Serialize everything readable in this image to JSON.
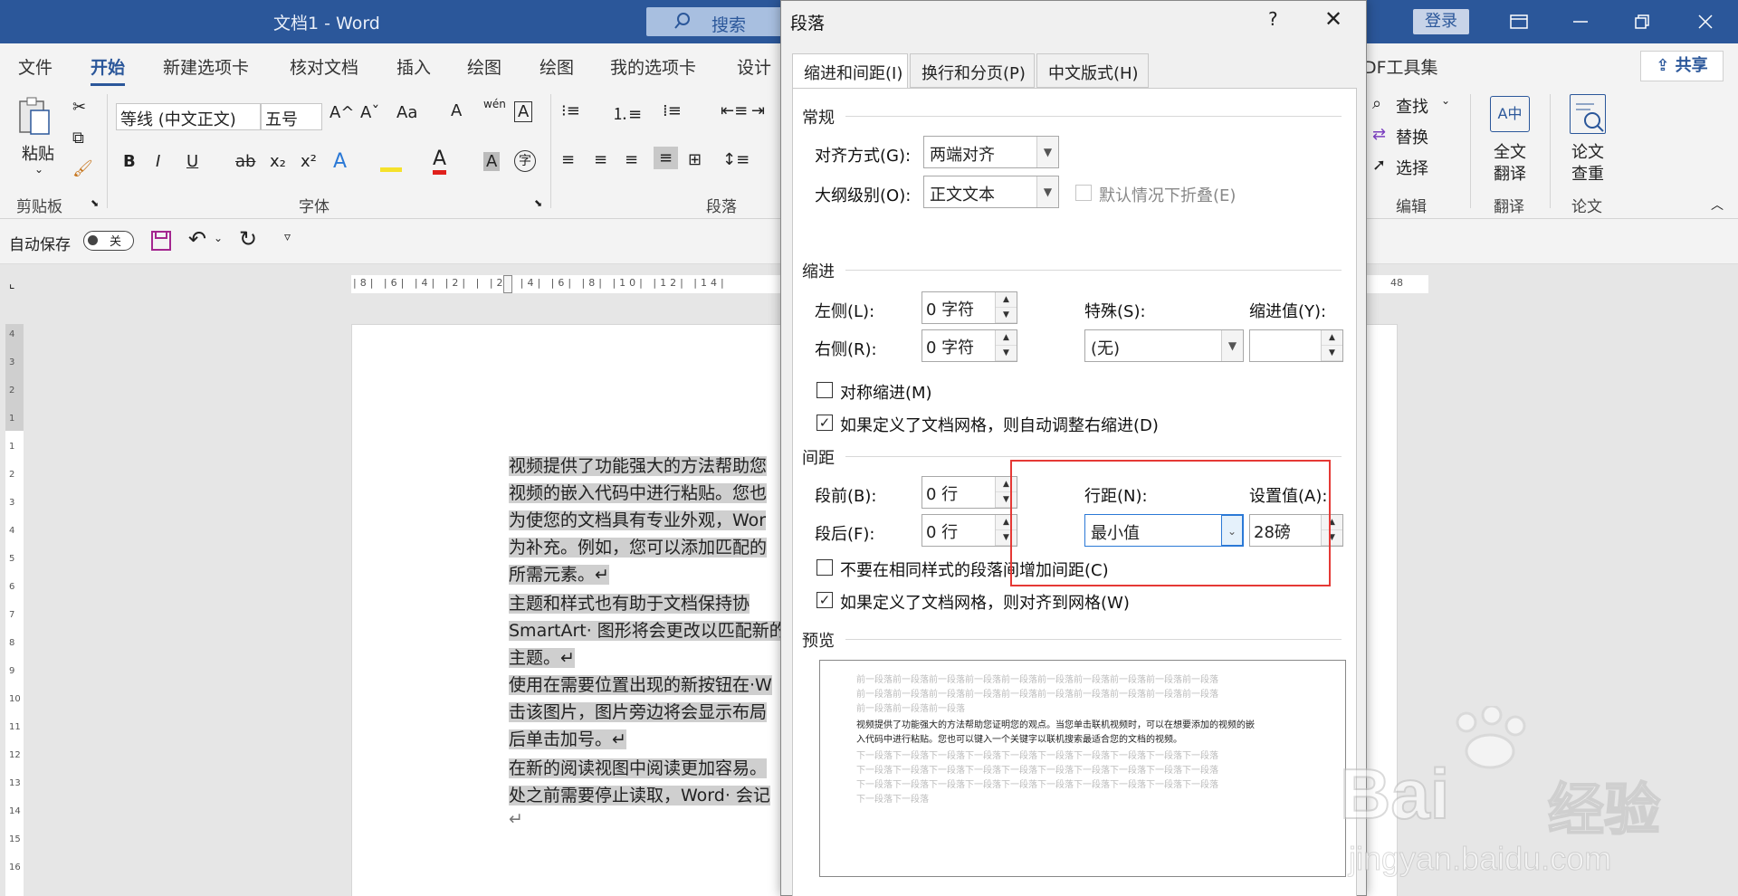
{
  "window": {
    "title": "文档1  -  Word",
    "search_label": "搜索",
    "login_label": "登录"
  },
  "ribbon_tabs": [
    "文件",
    "开始",
    "新建选项卡",
    "核对文档",
    "插入",
    "绘图",
    "绘图",
    "我的选项卡",
    "设计"
  ],
  "ribbon_tab_partial": "DF工具集",
  "share_label": "共享",
  "clipboard": {
    "paste_label": "粘贴",
    "group_label": "剪贴板"
  },
  "font": {
    "font_name": "等线 (中文正文)",
    "font_size": "五号",
    "group_label": "字体",
    "buttons": [
      "B",
      "I",
      "U",
      "ab",
      "x₂",
      "x²"
    ]
  },
  "paragraph": {
    "group_label": "段落"
  },
  "editing": {
    "find_label": "查找",
    "replace_label": "替换",
    "select_label": "选择",
    "group_label": "编辑"
  },
  "translate": {
    "btn_label_1": "全文",
    "btn_label_2": "翻译",
    "group_label": "翻译"
  },
  "paper": {
    "btn_label_1": "论文",
    "btn_label_2": "查重",
    "group_label": "论文"
  },
  "qat": {
    "autosave_label": "自动保存",
    "toggle_state": "关"
  },
  "ruler_top_ticks": "|8| |6| |4| |2| |  |2| |4| |6| |8| |10| |12| |14|",
  "ruler_right_label": "48",
  "ruler_left_ticks": [
    "4",
    "3",
    "2",
    "1",
    "1",
    "2",
    "3",
    "4",
    "5",
    "6",
    "7",
    "8",
    "9",
    "10",
    "11",
    "12",
    "13",
    "14",
    "15",
    "16"
  ],
  "document_lines": [
    "视频提供了功能强大的方法帮助您",
    "视频的嵌入代码中进行粘贴。您也",
    "为使您的文档具有专业外观，Wor",
    "为补充。例如，您可以添加匹配的",
    "所需元素。↵",
    "主题和样式也有助于文档保持协",
    "SmartArt· 图形将会更改以匹配新的",
    "主题。↵",
    "使用在需要位置出现的新按钮在·W",
    "击该图片，图片旁边将会显示布局",
    "后单击加号。↵",
    "在新的阅读视图中阅读更加容易。",
    "处之前需要停止读取，Word· 会记",
    "↵"
  ],
  "dialog": {
    "title": "段落",
    "help": "?",
    "tabs": [
      "缩进和间距(I)",
      "换行和分页(P)",
      "中文版式(H)"
    ],
    "general": {
      "section": "常规",
      "align_label": "对齐方式(G):",
      "align_value": "两端对齐",
      "outline_label": "大纲级别(O):",
      "outline_value": "正文文本",
      "collapse_label": "默认情况下折叠(E)"
    },
    "indent": {
      "section": "缩进",
      "left_label": "左侧(L):",
      "left_value": "0 字符",
      "right_label": "右侧(R):",
      "right_value": "0 字符",
      "special_label": "特殊(S):",
      "special_value": "(无)",
      "by_label": "缩进值(Y):",
      "by_value": "",
      "mirror_label": "对称缩进(M)",
      "auto_right_label": "如果定义了文档网格，则自动调整右缩进(D)"
    },
    "spacing": {
      "section": "间距",
      "before_label": "段前(B):",
      "before_value": "0 行",
      "after_label": "段后(F):",
      "after_value": "0 行",
      "line_label": "行距(N):",
      "line_value": "最小值",
      "at_label": "设置值(A):",
      "at_value": "28磅",
      "no_space_label": "不要在相同样式的段落间增加间距(C)",
      "snap_grid_label": "如果定义了文档网格，则对齐到网格(W)"
    },
    "preview": {
      "section": "预览",
      "prev_lines": [
        "前一段落前一段落前一段落前一段落前一段落前一段落前一段落前一段落前一段落前一段落",
        "前一段落前一段落前一段落前一段落前一段落前一段落前一段落前一段落前一段落前一段落",
        "前一段落前一段落前一段落"
      ],
      "sample_lines": [
        "视频提供了功能强大的方法帮助您证明您的观点。当您单击联机视频时，可以在想要添加的视频的嵌",
        "入代码中进行粘贴。您也可以键入一个关键字以联机搜索最适合您的文档的视频。"
      ],
      "next_lines": [
        "下一段落下一段落下一段落下一段落下一段落下一段落下一段落下一段落下一段落下一段落",
        "下一段落下一段落下一段落下一段落下一段落下一段落下一段落下一段落下一段落下一段落",
        "下一段落下一段落下一段落下一段落下一段落下一段落下一段落下一段落下一段落下一段落",
        "下一段落下一段落"
      ]
    }
  },
  "watermark": {
    "brand": "Bai",
    "brand2": "经验",
    "url": "jingyan.baidu.com"
  },
  "colors": {
    "accent": "#2b579a",
    "highlight_box": "#e53935"
  }
}
